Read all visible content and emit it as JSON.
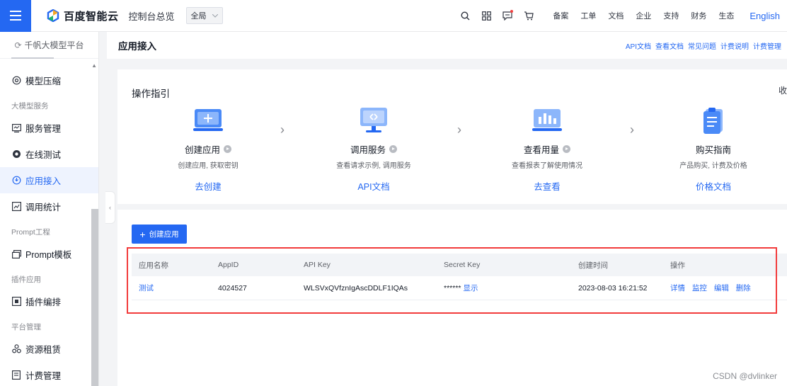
{
  "topbar": {
    "brand": "百度智能云",
    "console": "控制台总览",
    "region": "全局",
    "links": [
      "备案",
      "工单",
      "文档",
      "企业",
      "支持",
      "财务",
      "生态"
    ],
    "lang": "English",
    "icons": [
      "search-icon",
      "grid-icon",
      "message-icon",
      "cart-icon"
    ]
  },
  "sidebar": {
    "header": "千帆大模型平台",
    "items": [
      {
        "label": "模型压缩",
        "icon": "compress-icon"
      },
      {
        "group": "大模型服务"
      },
      {
        "label": "服务管理",
        "icon": "service-icon"
      },
      {
        "label": "在线测试",
        "icon": "test-icon"
      },
      {
        "label": "应用接入",
        "icon": "app-access-icon",
        "active": true
      },
      {
        "label": "调用统计",
        "icon": "stats-icon"
      },
      {
        "group": "Prompt工程"
      },
      {
        "label": "Prompt模板",
        "icon": "template-icon"
      },
      {
        "group": "插件应用"
      },
      {
        "label": "插件编排",
        "icon": "plugin-icon"
      },
      {
        "group": "平台管理"
      },
      {
        "label": "资源租赁",
        "icon": "resource-icon"
      },
      {
        "label": "计费管理",
        "icon": "billing-icon"
      }
    ]
  },
  "page": {
    "title": "应用接入",
    "header_links": [
      "API文档",
      "查看文档",
      "常见问题",
      "计费说明",
      "计费管理"
    ]
  },
  "guide": {
    "title": "操作指引",
    "collapse": "收",
    "steps": [
      {
        "name": "创建应用",
        "desc": "创建应用, 获取密钥",
        "link": "去创建"
      },
      {
        "name": "调用服务",
        "desc": "查看请求示例, 调用服务",
        "link": "API文档"
      },
      {
        "name": "查看用量",
        "desc": "查看报表了解使用情况",
        "link": "去查看"
      },
      {
        "name": "购买指南",
        "desc": "产品购买, 计费及价格",
        "link": "价格文档"
      }
    ]
  },
  "apps": {
    "create_button": "创建应用",
    "columns": [
      "应用名称",
      "AppID",
      "API Key",
      "Secret Key",
      "创建时间",
      "操作"
    ],
    "rows": [
      {
        "name": "测试",
        "app_id": "4024527",
        "api_key": "WLSVxQVfznIgAscDDLF1IQAs",
        "secret_mask": "******",
        "secret_show": "显示",
        "created": "2023-08-03 16:21:52",
        "ops": [
          "详情",
          "监控",
          "编辑",
          "删除"
        ]
      }
    ]
  },
  "watermark": "CSDN @dvlinker",
  "colors": {
    "accent": "#2468f2",
    "highlight": "#f23c3c"
  }
}
